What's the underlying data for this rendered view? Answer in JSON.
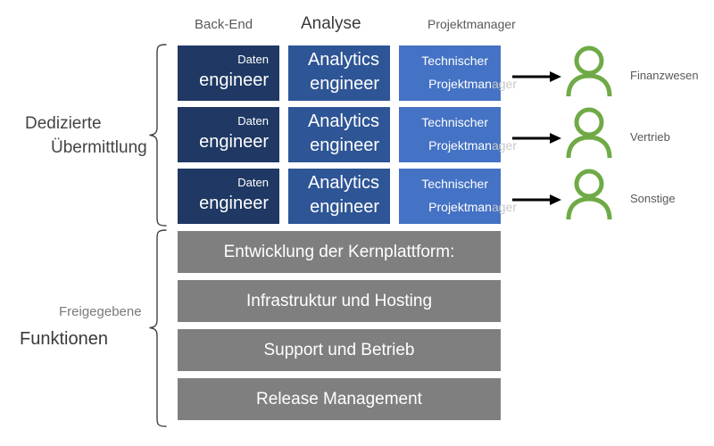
{
  "diagram": {
    "title": "Dedizierte Übermittlung und Freigegebene Funktionen",
    "colors": {
      "column_0": "#1F3864",
      "column_1": "#2E5596",
      "column_2": "#4472C4",
      "shared_bar": "#7F7F7F",
      "person": "#6FAA46",
      "arrow": "#000000"
    }
  },
  "column_headers": [
    {
      "label": "Back-End"
    },
    {
      "label": "Analyse"
    },
    {
      "label": "Projektmanager"
    }
  ],
  "groups": {
    "dedicated": {
      "line1": "Dedizierte",
      "line2": "Übermittlung"
    },
    "shared": {
      "line1": "Freigegebene",
      "line2": "Funktionen"
    }
  },
  "role_rows": [
    {
      "cells": [
        {
          "line1": "Daten",
          "line2": "engineer"
        },
        {
          "line1": "Analytics",
          "line2": "engineer"
        },
        {
          "line1": "Technischer",
          "line2": "Projektmanager",
          "line2_visible": "Projektman",
          "line2_spill": "ager"
        }
      ]
    },
    {
      "cells": [
        {
          "line1": "Daten",
          "line2": "engineer"
        },
        {
          "line1": "Analytics",
          "line2": "engineer"
        },
        {
          "line1": "Technischer",
          "line2": "Projektmanager",
          "line2_visible": "Projektman",
          "line2_spill": "ager"
        }
      ]
    },
    {
      "cells": [
        {
          "line1": "Daten",
          "line2": "engineer"
        },
        {
          "line1": "Analytics",
          "line2": "engineer"
        },
        {
          "line1": "Technischer",
          "line2": "Projektmanager",
          "line2_visible": "Projektman",
          "line2_spill": "ager"
        }
      ]
    }
  ],
  "shared_functions": [
    {
      "label": "Entwicklung der Kernplattform:"
    },
    {
      "label": "Infrastruktur und Hosting"
    },
    {
      "label": "Support und Betrieb"
    },
    {
      "label": "Release Management"
    }
  ],
  "consumers": [
    {
      "label": "Finanzwesen",
      "icon": "person-icon"
    },
    {
      "label": "Vertrieb",
      "icon": "person-icon"
    },
    {
      "label": "Sonstige",
      "icon": "person-icon"
    }
  ]
}
